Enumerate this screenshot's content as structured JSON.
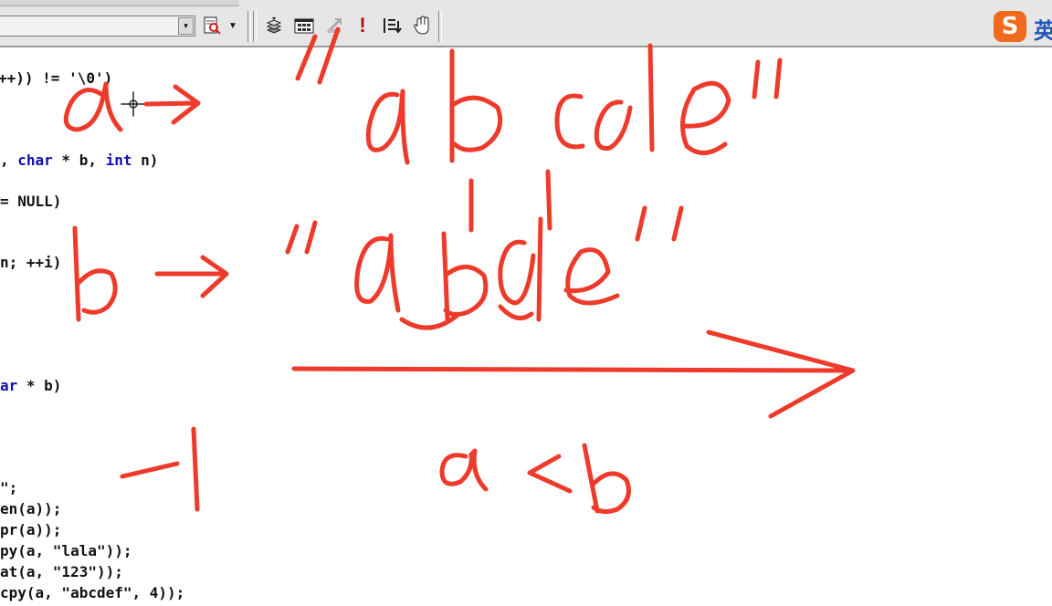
{
  "toolbar": {
    "combo_value": "",
    "combo_arrow": "▾",
    "icons": [
      "find-in-files-icon",
      "dropdown-arrow-icon",
      "compile-icon",
      "build-icon",
      "stop-build-icon",
      "execute-icon",
      "go-icon",
      "breakpoint-hand-icon"
    ],
    "ime_logo": "S",
    "ime_mode": "英",
    "ime_color": "#f06a1e"
  },
  "code": {
    "lines": [
      "++)) != '\\0')",
      ", char * b, int n)",
      "= NULL)",
      "n; ++i)",
      "ar * b)",
      "\";",
      "en(a));",
      "pr(a));",
      "py(a, \"lala\"));",
      "at(a, \"123\"));",
      "cpy(a, \"abcdef\", 4));"
    ],
    "keyword_color": "#1010b0"
  },
  "annotation": {
    "ink_color": "#ee3a2a",
    "line1_label": "a",
    "line1_string": "\"abcde\"",
    "line2_label": "b",
    "line2_string": "\"abde\"",
    "result_label": "-1",
    "comparison": "a<b"
  }
}
